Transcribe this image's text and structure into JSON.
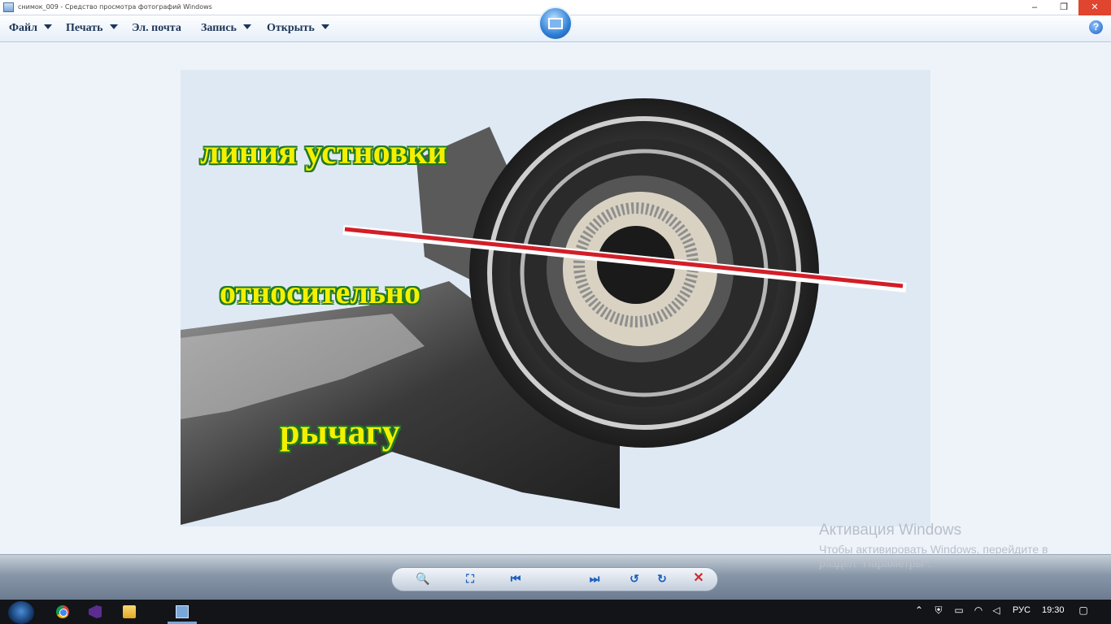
{
  "window": {
    "title": "снимок_009 - Средство просмотра фотографий Windows",
    "minimize": "–",
    "restore": "❐",
    "close": "✕"
  },
  "menu": {
    "items": [
      {
        "label": "Файл"
      },
      {
        "label": "Печать"
      },
      {
        "label": "Эл. почта"
      },
      {
        "label": "Запись"
      },
      {
        "label": "Открыть"
      }
    ],
    "help": "?"
  },
  "photo": {
    "captions": [
      "линия устновки",
      "относительно",
      "рычагу"
    ]
  },
  "activation": {
    "title": "Активация Windows",
    "text": "Чтобы активировать Windows, перейдите в раздел \"Параметры\"."
  },
  "controls": {
    "zoom": "🔍",
    "fit": "⛶",
    "prev": "⏮",
    "next": "⏭",
    "rotate_left": "↺",
    "rotate_right": "↻",
    "delete": "✕"
  },
  "taskbar": {
    "language": "РУС",
    "time": "19:30"
  },
  "colors": {
    "caption_fill": "#f4f000",
    "caption_outline": "#1f7a23",
    "close_button": "#e0452f",
    "red_line": "#d21e28"
  }
}
